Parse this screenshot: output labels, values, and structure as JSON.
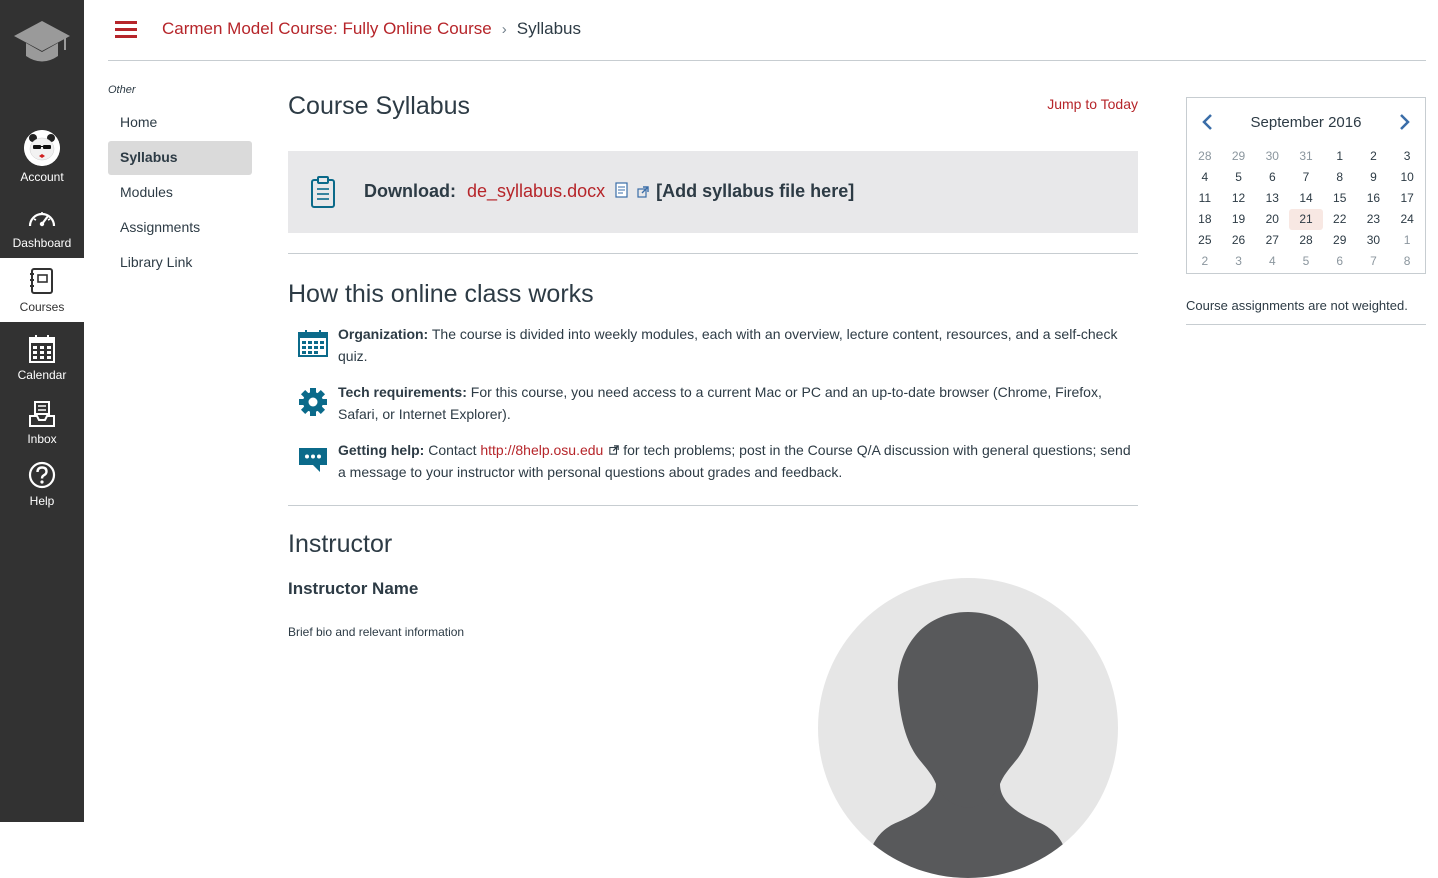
{
  "global_nav": {
    "items": [
      {
        "label": "Account",
        "icon": "account-avatar-icon"
      },
      {
        "label": "Dashboard",
        "icon": "dashboard-icon"
      },
      {
        "label": "Courses",
        "icon": "courses-icon"
      },
      {
        "label": "Calendar",
        "icon": "calendar-icon"
      },
      {
        "label": "Inbox",
        "icon": "inbox-icon"
      },
      {
        "label": "Help",
        "icon": "help-icon"
      }
    ],
    "active": "Courses"
  },
  "header": {
    "course_name": "Carmen Model Course: Fully Online Course",
    "separator": "›",
    "current_page": "Syllabus"
  },
  "course_nav": {
    "section_label": "Other",
    "items": [
      "Home",
      "Syllabus",
      "Modules",
      "Assignments",
      "Library Link"
    ],
    "active": "Syllabus"
  },
  "main": {
    "title": "Course Syllabus",
    "jump_to_today": "Jump to Today",
    "download": {
      "label": "Download:",
      "file": "de_syllabus.docx",
      "add_file": "[Add syllabus file here]"
    },
    "how_title": "How this online class works",
    "how_items": [
      {
        "heading": "Organization:",
        "text": " The course is divided into weekly modules, each with an overview, lecture content, resources, and a self-check quiz."
      },
      {
        "heading": "Tech requirements:",
        "text": " For this course, you need access to a current Mac or PC and an up-to-date browser (Chrome, Firefox, Safari, or Internet Explorer)."
      },
      {
        "heading": "Getting help:",
        "text_before": " Contact ",
        "link": "http://8help.osu.edu",
        "text_after": "  for tech problems; post in the Course Q/A discussion with general questions; send a message to your instructor with personal questions about grades and feedback."
      }
    ],
    "instructor_title": "Instructor",
    "instructor_name": "Instructor Name",
    "instructor_bio": "Brief bio and relevant information"
  },
  "calendar": {
    "month_label": "September 2016",
    "weeks": [
      [
        "28",
        "29",
        "30",
        "31",
        "1",
        "2",
        "3"
      ],
      [
        "4",
        "5",
        "6",
        "7",
        "8",
        "9",
        "10"
      ],
      [
        "11",
        "12",
        "13",
        "14",
        "15",
        "16",
        "17"
      ],
      [
        "18",
        "19",
        "20",
        "21",
        "22",
        "23",
        "24"
      ],
      [
        "25",
        "26",
        "27",
        "28",
        "29",
        "30",
        "1"
      ],
      [
        "2",
        "3",
        "4",
        "5",
        "6",
        "7",
        "8"
      ]
    ],
    "today": "21",
    "note": "Course assignments are not weighted."
  },
  "colors": {
    "brand_red": "#b6252a",
    "nav_bg": "#323232",
    "teal_icon": "#0b6a8a"
  }
}
